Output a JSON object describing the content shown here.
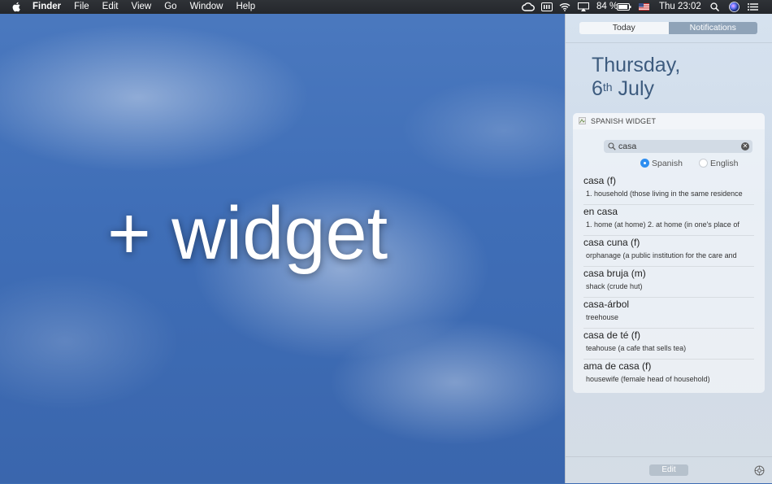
{
  "menubar": {
    "app_name": "Finder",
    "menus": [
      "File",
      "Edit",
      "View",
      "Go",
      "Window",
      "Help"
    ],
    "battery": "84 %",
    "clock": "Thu 23:02"
  },
  "desktop": {
    "headline": "+ widget"
  },
  "notification_center": {
    "tabs": {
      "today": "Today",
      "notifications": "Notifications"
    },
    "date_weekday": "Thursday,",
    "date_day": "6",
    "date_suffix": "th",
    "date_month": "July",
    "edit_label": "Edit"
  },
  "widget": {
    "title": "SPANISH WIDGET",
    "search_value": "casa",
    "radio_spanish": "Spanish",
    "radio_english": "English",
    "selected_language": "Spanish",
    "results": [
      {
        "term": "casa (f)",
        "definition": "1. household (those living in the same residence"
      },
      {
        "term": "en casa",
        "definition": "1. home (at home) 2. at home (in one's place of"
      },
      {
        "term": "casa cuna (f)",
        "definition": "orphanage (a public institution for the care and"
      },
      {
        "term": "casa bruja (m)",
        "definition": "shack (crude hut)"
      },
      {
        "term": "casa-árbol",
        "definition": "treehouse"
      },
      {
        "term": "casa de té (f)",
        "definition": "teahouse (a cafe that sells tea)"
      },
      {
        "term": "ama de casa (f)",
        "definition": "housewife (female head of household)"
      }
    ]
  },
  "colors": {
    "accent": "#2e8ef0",
    "date_text": "#3d5b7e"
  }
}
